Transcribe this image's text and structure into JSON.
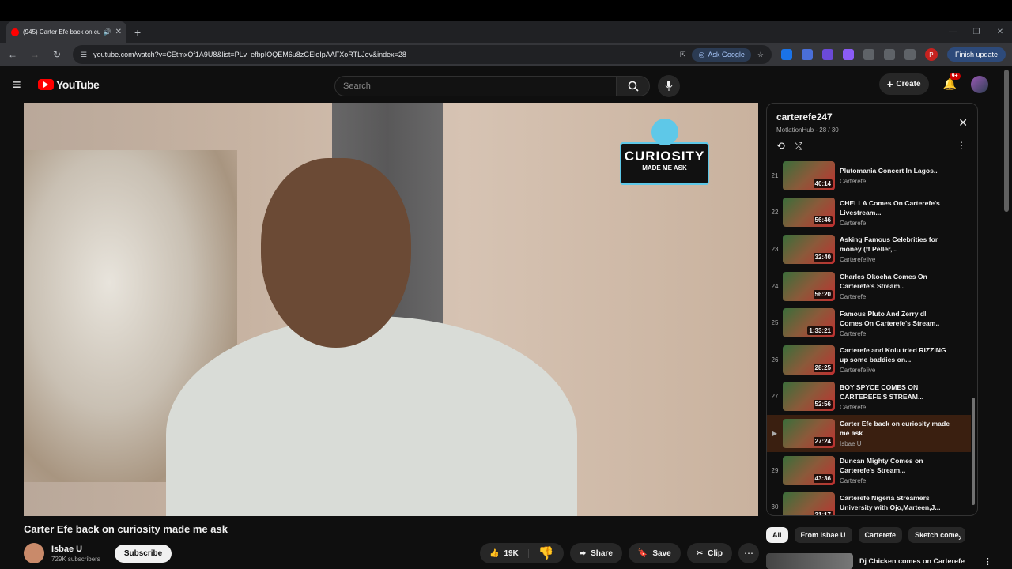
{
  "browser": {
    "tab_title": "(945) Carter Efe back on cu",
    "url": "youtube.com/watch?v=CEtmxQf1A9U8&list=PLv_efbpIOQEM6u8zGEloIpAAFXoRTLJev&index=28",
    "ask_google": "Ask Google",
    "profile_letter": "P",
    "finish_update": "Finish update"
  },
  "youtube": {
    "logo_text": "YouTube",
    "search_placeholder": "Search",
    "create_label": "Create",
    "notifications_badge": "9+"
  },
  "video": {
    "overlay_line1": "CURIOSITY",
    "overlay_line2": "MADE ME ASK",
    "title": "Carter Efe back on curiosity made me ask",
    "channel": "Isbae U",
    "subscribers": "729K subscribers",
    "subscribe_label": "Subscribe",
    "likes": "19K",
    "share_label": "Share",
    "save_label": "Save",
    "clip_label": "Clip"
  },
  "playlist": {
    "title": "carterefe247",
    "subtitle": "MotlationHub - 28 / 30",
    "items": [
      {
        "index": "21",
        "title": "Plutomania Concert In Lagos..",
        "channel": "Carterefe",
        "duration": "40:14"
      },
      {
        "index": "22",
        "title": "CHELLA Comes On Carterefe's Livestream...",
        "channel": "Carterefe",
        "duration": "56:46"
      },
      {
        "index": "23",
        "title": "Asking Famous Celebrities for money (ft Peller,...",
        "channel": "Carterefelive",
        "duration": "32:40"
      },
      {
        "index": "24",
        "title": "Charles Okocha Comes On Carterefe's Stream..",
        "channel": "Carterefe",
        "duration": "56:20"
      },
      {
        "index": "25",
        "title": "Famous Pluto And Zerry dl Comes On Carterefe's Stream..",
        "channel": "Carterefe",
        "duration": "1:33:21"
      },
      {
        "index": "26",
        "title": "Carterefe and Kolu tried RIZZING up some baddies on...",
        "channel": "Carterefelive",
        "duration": "28:25"
      },
      {
        "index": "27",
        "title": "BOY SPYCE COMES ON CARTEREFE'S STREAM...",
        "channel": "Carterefe",
        "duration": "52:56"
      },
      {
        "index": "▶",
        "title": "Carter Efe back on curiosity made me ask",
        "channel": "Isbae U",
        "duration": "27:24",
        "active": true
      },
      {
        "index": "29",
        "title": "Duncan Mighty Comes on Carterefe's Stream...",
        "channel": "Carterefe",
        "duration": "43:36"
      },
      {
        "index": "30",
        "title": "Carterefe Nigeria Streamers University with Ojo,Marteen,J...",
        "channel": "Carterefelive",
        "duration": "31:17"
      }
    ]
  },
  "chips": [
    "All",
    "From Isbae U",
    "Carterefe",
    "Sketch come"
  ],
  "next_recommendation": {
    "title": "Dj Chicken comes on Carterefe"
  }
}
